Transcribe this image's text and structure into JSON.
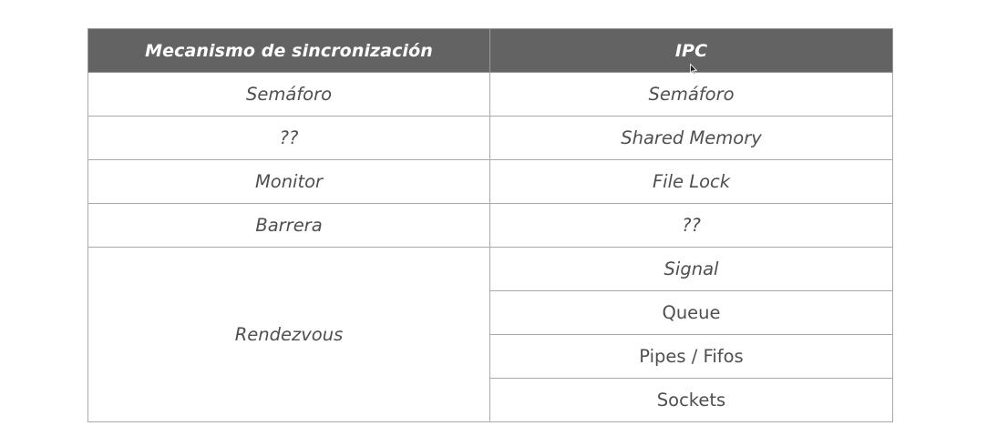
{
  "table": {
    "headers": [
      "Mecanismo de sincronización",
      "IPC"
    ],
    "rows": [
      {
        "sync": "Semáforo",
        "ipc": "Semáforo"
      },
      {
        "sync": "??",
        "ipc": "Shared Memory"
      },
      {
        "sync": "Monitor",
        "ipc": "File Lock"
      },
      {
        "sync": "Barrera",
        "ipc": "??"
      }
    ],
    "rendezvous": {
      "sync": "Rendezvous",
      "ipc": [
        "Signal",
        "Queue",
        "Pipes / Fifos",
        "Sockets"
      ]
    }
  },
  "colors": {
    "header_bg": "#636363",
    "header_text": "#ffffff",
    "cell_text": "#4f4f4f",
    "border": "#a9a9a9"
  },
  "icons": {
    "cursor": "mouse-pointer-icon"
  }
}
